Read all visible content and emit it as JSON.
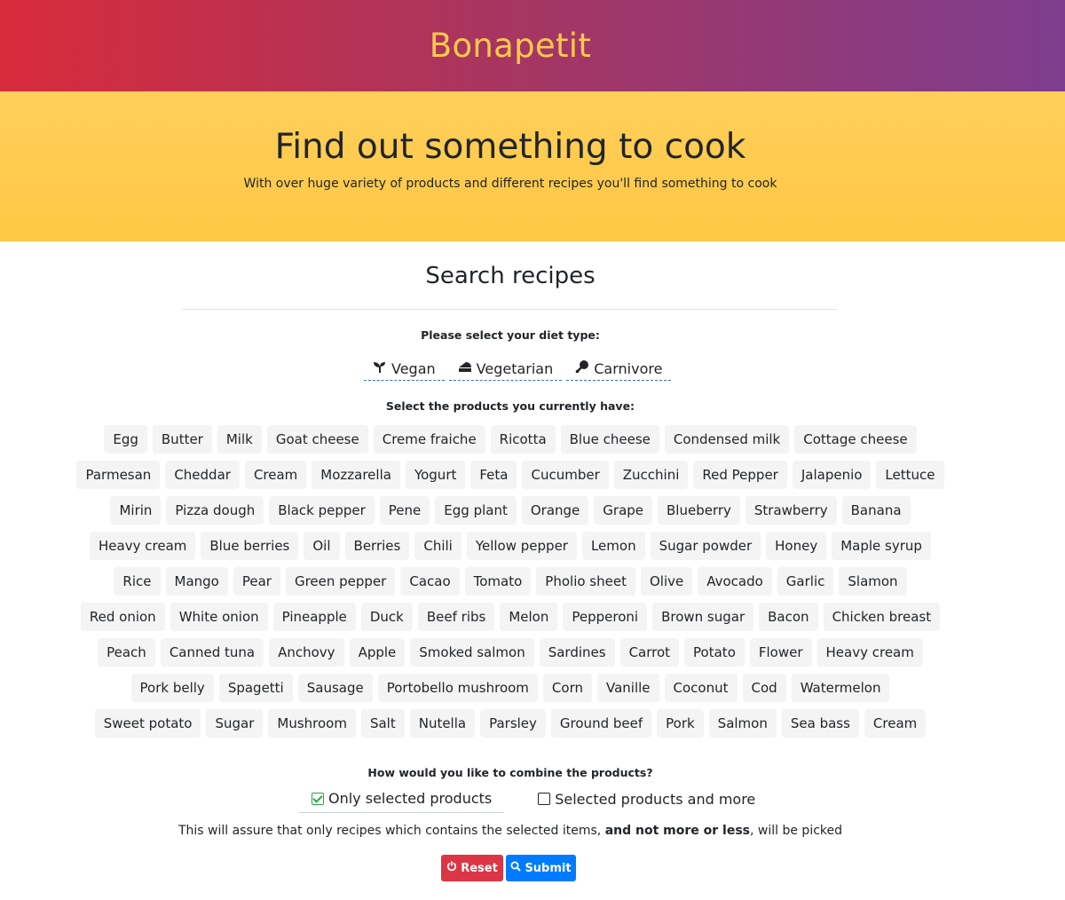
{
  "navbar": {
    "brand": "Bonapetit"
  },
  "hero": {
    "title": "Find out something to cook",
    "subtitle": "With over huge variety of products and different recipes you'll find something to cook"
  },
  "search": {
    "title": "Search recipes",
    "diet_label": "Please select your diet type:",
    "diets": [
      {
        "label": "Vegan",
        "icon": "seedling-icon"
      },
      {
        "label": "Vegetarian",
        "icon": "cheese-icon"
      },
      {
        "label": "Carnivore",
        "icon": "drumstick-icon"
      }
    ],
    "products_label": "Select the products you currently have:",
    "products": [
      "Egg",
      "Butter",
      "Milk",
      "Goat cheese",
      "Creme fraiche",
      "Ricotta",
      "Blue cheese",
      "Condensed milk",
      "Cottage cheese",
      "Parmesan",
      "Cheddar",
      "Cream",
      "Mozzarella",
      "Yogurt",
      "Feta",
      "Cucumber",
      "Zucchini",
      "Red Pepper",
      "Jalapenio",
      "Lettuce",
      "Mirin",
      "Pizza dough",
      "Black pepper",
      "Pene",
      "Egg plant",
      "Orange",
      "Grape",
      "Blueberry",
      "Strawberry",
      "Banana",
      "Heavy cream",
      "Blue berries",
      "Oil",
      "Berries",
      "Chili",
      "Yellow pepper",
      "Lemon",
      "Sugar powder",
      "Honey",
      "Maple syrup",
      "Rice",
      "Mango",
      "Pear",
      "Green pepper",
      "Cacao",
      "Tomato",
      "Pholio sheet",
      "Olive",
      "Avocado",
      "Garlic",
      "Slamon",
      "Red onion",
      "White onion",
      "Pineapple",
      "Duck",
      "Beef ribs",
      "Melon",
      "Pepperoni",
      "Brown sugar",
      "Bacon",
      "Chicken breast",
      "Peach",
      "Canned tuna",
      "Anchovy",
      "Apple",
      "Smoked salmon",
      "Sardines",
      "Carrot",
      "Potato",
      "Flower",
      "Heavy cream",
      "Pork belly",
      "Spagetti",
      "Sausage",
      "Portobello mushroom",
      "Corn",
      "Vanille",
      "Coconut",
      "Cod",
      "Watermelon",
      "Sweet potato",
      "Sugar",
      "Mushroom",
      "Salt",
      "Nutella",
      "Parsley",
      "Ground beef",
      "Pork",
      "Salmon",
      "Sea bass",
      "Cream"
    ],
    "combine_label": "How would you like to combine the products?",
    "combine_options": [
      {
        "label": "Only selected products",
        "checked": true
      },
      {
        "label": "Selected products and more",
        "checked": false
      }
    ],
    "assure_prefix": "This will assure that only recipes which contains the selected items, ",
    "assure_bold": "and not more or less",
    "assure_suffix": ", will be picked",
    "reset_label": "Reset",
    "submit_label": "Submit"
  },
  "colors": {
    "brand": "#ffc94d",
    "hero_bg": "#ffcd55",
    "reset": "#dc3545",
    "submit": "#007bff",
    "check": "#28a745"
  }
}
